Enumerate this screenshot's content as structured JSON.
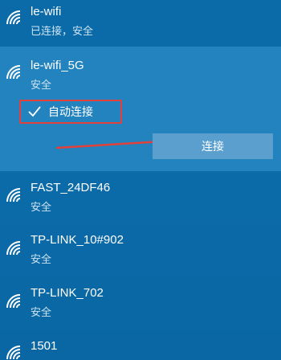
{
  "networks": [
    {
      "name": "le-wifi",
      "status": "已连接，安全",
      "icon": "wifi-signal-icon"
    },
    {
      "name": "le-wifi_5G",
      "status": "安全",
      "icon": "wifi-signal-icon",
      "auto_connect": {
        "label": "自动连接",
        "checked": true
      },
      "connect_label": "连接"
    },
    {
      "name": "FAST_24DF46",
      "status": "安全",
      "icon": "wifi-signal-icon"
    },
    {
      "name": "TP-LINK_10#902",
      "status": "安全",
      "icon": "wifi-signal-icon"
    },
    {
      "name": "TP-LINK_702",
      "status": "安全",
      "icon": "wifi-signal-icon"
    },
    {
      "name": "1501",
      "icon": "wifi-signal-icon"
    }
  ],
  "colors": {
    "background": "#0a6aa8",
    "expanded_background": "#2383bf",
    "connect_button": "#5a9fce",
    "highlight_red": "#e2403a"
  },
  "annotation": {
    "arrow_icon": "red-arrow-icon",
    "highlight": "red-highlight-box"
  }
}
